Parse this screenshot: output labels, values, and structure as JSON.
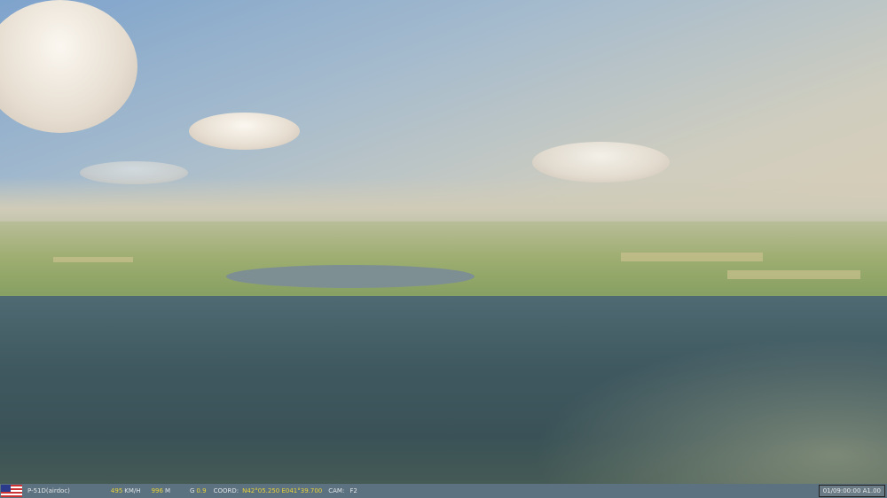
{
  "hud": {
    "aircraft": "P-51D(airdoc)",
    "speed_value": "495",
    "speed_unit": "KM/H",
    "altitude_value": "996",
    "altitude_unit": "M",
    "g_label": "G",
    "g_value": "0.9",
    "coord_label": "COORD:",
    "coord_value": "N42°05.250 E041°39.700",
    "cam_label": "CAM:",
    "cam_value": "F2",
    "time": "01/09:00:00 A1.00"
  },
  "colors": {
    "status_bar": "#5d7280",
    "value_yellow": "#e8d23a"
  }
}
